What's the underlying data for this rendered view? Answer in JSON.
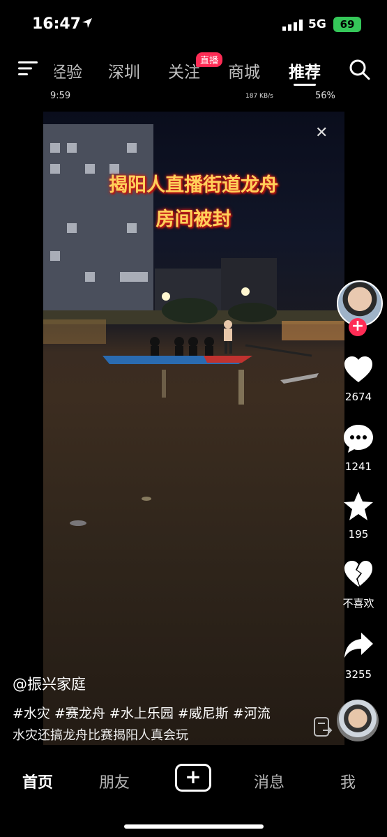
{
  "status_bar": {
    "time": "16:47",
    "network": "5G",
    "battery": "69"
  },
  "top_nav": {
    "tabs": [
      "经验",
      "深圳",
      "关注",
      "商城",
      "推荐"
    ],
    "live_badge": "直播"
  },
  "video": {
    "inner_status": {
      "time": "9:59",
      "right": "187 KB/s",
      "battery": "56%"
    },
    "caption_line1": "揭阳人直播街道龙舟",
    "caption_line2": "房间被封"
  },
  "actions": {
    "like_count": "2674",
    "comment_count": "1241",
    "favorite_count": "195",
    "dislike_label": "不喜欢",
    "share_count": "3255"
  },
  "post": {
    "author": "@振兴家庭",
    "hashtags": "#水灾 #赛龙舟 #水上乐园 #威尼斯 #河流",
    "description": "水灾还搞龙舟比赛揭阳人真会玩"
  },
  "bottom_nav": {
    "home": "首页",
    "friends": "朋友",
    "create": "+",
    "messages": "消息",
    "me": "我"
  },
  "colors": {
    "accent": "#fe2c55",
    "battery": "#35c759",
    "caption": "#ffd05a"
  }
}
